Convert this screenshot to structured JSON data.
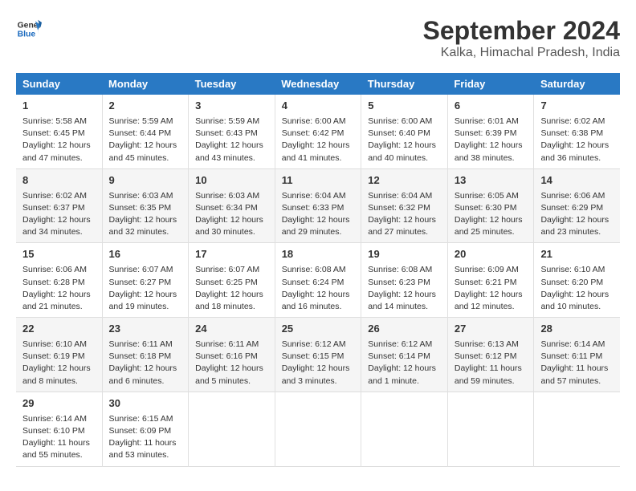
{
  "logo": {
    "line1": "General",
    "line2": "Blue"
  },
  "title": "September 2024",
  "subtitle": "Kalka, Himachal Pradesh, India",
  "days_of_week": [
    "Sunday",
    "Monday",
    "Tuesday",
    "Wednesday",
    "Thursday",
    "Friday",
    "Saturday"
  ],
  "weeks": [
    [
      {
        "day": "1",
        "info": "Sunrise: 5:58 AM\nSunset: 6:45 PM\nDaylight: 12 hours\nand 47 minutes."
      },
      {
        "day": "2",
        "info": "Sunrise: 5:59 AM\nSunset: 6:44 PM\nDaylight: 12 hours\nand 45 minutes."
      },
      {
        "day": "3",
        "info": "Sunrise: 5:59 AM\nSunset: 6:43 PM\nDaylight: 12 hours\nand 43 minutes."
      },
      {
        "day": "4",
        "info": "Sunrise: 6:00 AM\nSunset: 6:42 PM\nDaylight: 12 hours\nand 41 minutes."
      },
      {
        "day": "5",
        "info": "Sunrise: 6:00 AM\nSunset: 6:40 PM\nDaylight: 12 hours\nand 40 minutes."
      },
      {
        "day": "6",
        "info": "Sunrise: 6:01 AM\nSunset: 6:39 PM\nDaylight: 12 hours\nand 38 minutes."
      },
      {
        "day": "7",
        "info": "Sunrise: 6:02 AM\nSunset: 6:38 PM\nDaylight: 12 hours\nand 36 minutes."
      }
    ],
    [
      {
        "day": "8",
        "info": "Sunrise: 6:02 AM\nSunset: 6:37 PM\nDaylight: 12 hours\nand 34 minutes."
      },
      {
        "day": "9",
        "info": "Sunrise: 6:03 AM\nSunset: 6:35 PM\nDaylight: 12 hours\nand 32 minutes."
      },
      {
        "day": "10",
        "info": "Sunrise: 6:03 AM\nSunset: 6:34 PM\nDaylight: 12 hours\nand 30 minutes."
      },
      {
        "day": "11",
        "info": "Sunrise: 6:04 AM\nSunset: 6:33 PM\nDaylight: 12 hours\nand 29 minutes."
      },
      {
        "day": "12",
        "info": "Sunrise: 6:04 AM\nSunset: 6:32 PM\nDaylight: 12 hours\nand 27 minutes."
      },
      {
        "day": "13",
        "info": "Sunrise: 6:05 AM\nSunset: 6:30 PM\nDaylight: 12 hours\nand 25 minutes."
      },
      {
        "day": "14",
        "info": "Sunrise: 6:06 AM\nSunset: 6:29 PM\nDaylight: 12 hours\nand 23 minutes."
      }
    ],
    [
      {
        "day": "15",
        "info": "Sunrise: 6:06 AM\nSunset: 6:28 PM\nDaylight: 12 hours\nand 21 minutes."
      },
      {
        "day": "16",
        "info": "Sunrise: 6:07 AM\nSunset: 6:27 PM\nDaylight: 12 hours\nand 19 minutes."
      },
      {
        "day": "17",
        "info": "Sunrise: 6:07 AM\nSunset: 6:25 PM\nDaylight: 12 hours\nand 18 minutes."
      },
      {
        "day": "18",
        "info": "Sunrise: 6:08 AM\nSunset: 6:24 PM\nDaylight: 12 hours\nand 16 minutes."
      },
      {
        "day": "19",
        "info": "Sunrise: 6:08 AM\nSunset: 6:23 PM\nDaylight: 12 hours\nand 14 minutes."
      },
      {
        "day": "20",
        "info": "Sunrise: 6:09 AM\nSunset: 6:21 PM\nDaylight: 12 hours\nand 12 minutes."
      },
      {
        "day": "21",
        "info": "Sunrise: 6:10 AM\nSunset: 6:20 PM\nDaylight: 12 hours\nand 10 minutes."
      }
    ],
    [
      {
        "day": "22",
        "info": "Sunrise: 6:10 AM\nSunset: 6:19 PM\nDaylight: 12 hours\nand 8 minutes."
      },
      {
        "day": "23",
        "info": "Sunrise: 6:11 AM\nSunset: 6:18 PM\nDaylight: 12 hours\nand 6 minutes."
      },
      {
        "day": "24",
        "info": "Sunrise: 6:11 AM\nSunset: 6:16 PM\nDaylight: 12 hours\nand 5 minutes."
      },
      {
        "day": "25",
        "info": "Sunrise: 6:12 AM\nSunset: 6:15 PM\nDaylight: 12 hours\nand 3 minutes."
      },
      {
        "day": "26",
        "info": "Sunrise: 6:12 AM\nSunset: 6:14 PM\nDaylight: 12 hours\nand 1 minute."
      },
      {
        "day": "27",
        "info": "Sunrise: 6:13 AM\nSunset: 6:12 PM\nDaylight: 11 hours\nand 59 minutes."
      },
      {
        "day": "28",
        "info": "Sunrise: 6:14 AM\nSunset: 6:11 PM\nDaylight: 11 hours\nand 57 minutes."
      }
    ],
    [
      {
        "day": "29",
        "info": "Sunrise: 6:14 AM\nSunset: 6:10 PM\nDaylight: 11 hours\nand 55 minutes."
      },
      {
        "day": "30",
        "info": "Sunrise: 6:15 AM\nSunset: 6:09 PM\nDaylight: 11 hours\nand 53 minutes."
      },
      {
        "day": "",
        "info": ""
      },
      {
        "day": "",
        "info": ""
      },
      {
        "day": "",
        "info": ""
      },
      {
        "day": "",
        "info": ""
      },
      {
        "day": "",
        "info": ""
      }
    ]
  ]
}
